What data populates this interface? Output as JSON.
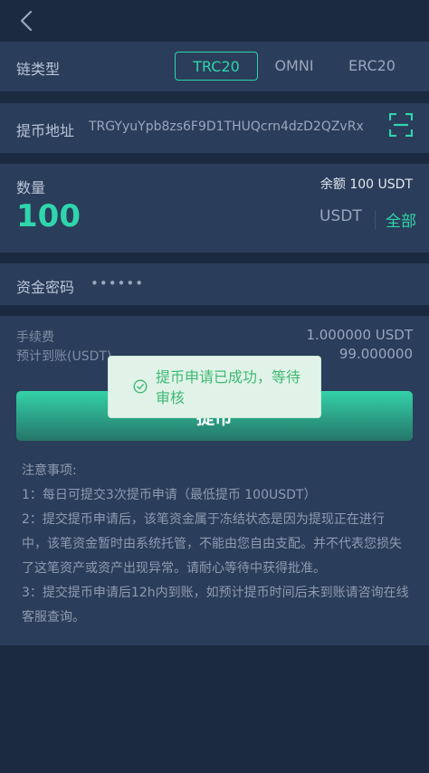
{
  "chain": {
    "label": "链类型",
    "options": [
      "TRC20",
      "OMNI",
      "ERC20"
    ],
    "selected": "TRC20"
  },
  "address": {
    "label": "提币地址",
    "value": "TRGYyuYpb8zs6F9D1THUQcrn4dzD2QZvRx"
  },
  "amount": {
    "label": "数量",
    "balance": "余额 100 USDT",
    "value": "100",
    "unit": "USDT",
    "all_label": "全部"
  },
  "password": {
    "label": "资金密码",
    "value": "••••••"
  },
  "fee": {
    "fee_label": "手续费",
    "fee_value": "1.000000 USDT",
    "arrival_label": "预计到账(USDT)",
    "arrival_value": "99.000000"
  },
  "submit_label": "提币",
  "notes": {
    "title": "注意事项:",
    "lines": [
      "1：每日可提交3次提币申请（最低提币 100USDT）",
      "2：提交提币申请后，该笔资金属于冻结状态是因为提现正在进行中，该笔资金暂时由系统托管，不能由您自由支配。并不代表您损失了这笔资产或资产出现异常。请耐心等待中获得批准。",
      "3：提交提币申请后12h内到账，如预计提币时间后未到账请咨询在线客服查询。"
    ]
  },
  "toast": {
    "message": "提币申请已成功，等待审核",
    "color": "#3fb874"
  },
  "colors": {
    "accent": "#2fd5ac",
    "background": "#1b2941",
    "card": "#2a3d5a"
  }
}
